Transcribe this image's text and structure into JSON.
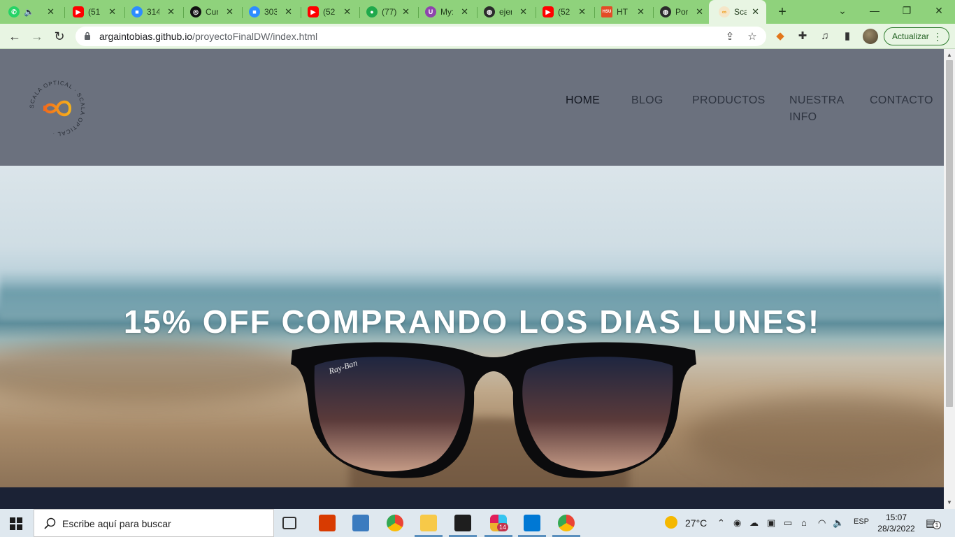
{
  "browser": {
    "tabs": [
      {
        "title": "",
        "favicon": "whatsapp-icon",
        "color": "#25d366"
      },
      {
        "title": "",
        "favicon": "speaker-icon",
        "color": "#1f3a1a"
      },
      {
        "title": "(51",
        "favicon": "youtube-icon",
        "color": "#ff0000"
      },
      {
        "title": "314",
        "favicon": "zoom-icon",
        "color": "#2d8cff"
      },
      {
        "title": "Cur",
        "favicon": "course-icon",
        "color": "#111111"
      },
      {
        "title": "303",
        "favicon": "zoom-icon",
        "color": "#2d8cff"
      },
      {
        "title": "(52",
        "favicon": "youtube-icon",
        "color": "#ff0000"
      },
      {
        "title": "(77)",
        "favicon": "chat-icon",
        "color": "#1fa94b"
      },
      {
        "title": "My:",
        "favicon": "shield-icon",
        "color": "#8e44ad"
      },
      {
        "title": "ejer",
        "favicon": "globe-icon",
        "color": "#2b2b2b"
      },
      {
        "title": "(52",
        "favicon": "youtube-icon",
        "color": "#ff0000"
      },
      {
        "title": "HT",
        "favicon": "html-icon",
        "color": "#e34c26"
      },
      {
        "title": "Por",
        "favicon": "globe-icon",
        "color": "#2b2b2b"
      },
      {
        "title": "Sca",
        "favicon": "scala-icon",
        "color": "#f0a020"
      }
    ],
    "url_host": "argaintobias.github.io",
    "url_path": "/proyectoFinalDW/index.html",
    "update_label": "Actualizar"
  },
  "site": {
    "nav": [
      {
        "label": "HOME"
      },
      {
        "label": "BLOG"
      },
      {
        "label": "PRODUCTOS"
      },
      {
        "label": "NUESTRA\nINFO"
      },
      {
        "label": "CONTACTO"
      }
    ],
    "logo_text": "SCALA OPTICAL",
    "hero_title": "15% OFF COMPRANDO LOS DIAS LUNES!",
    "brand_on_glasses": "Ray-Ban"
  },
  "taskbar": {
    "search_placeholder": "Escribe aquí para buscar",
    "weather": "27°C",
    "language": "ESP",
    "time": "15:07",
    "date": "28/3/2022",
    "notifications": "1",
    "slack_badge": "14"
  },
  "colors": {
    "tabstrip": "#8fd27c",
    "header": "#6b717e",
    "dark_band": "#1b2235"
  }
}
